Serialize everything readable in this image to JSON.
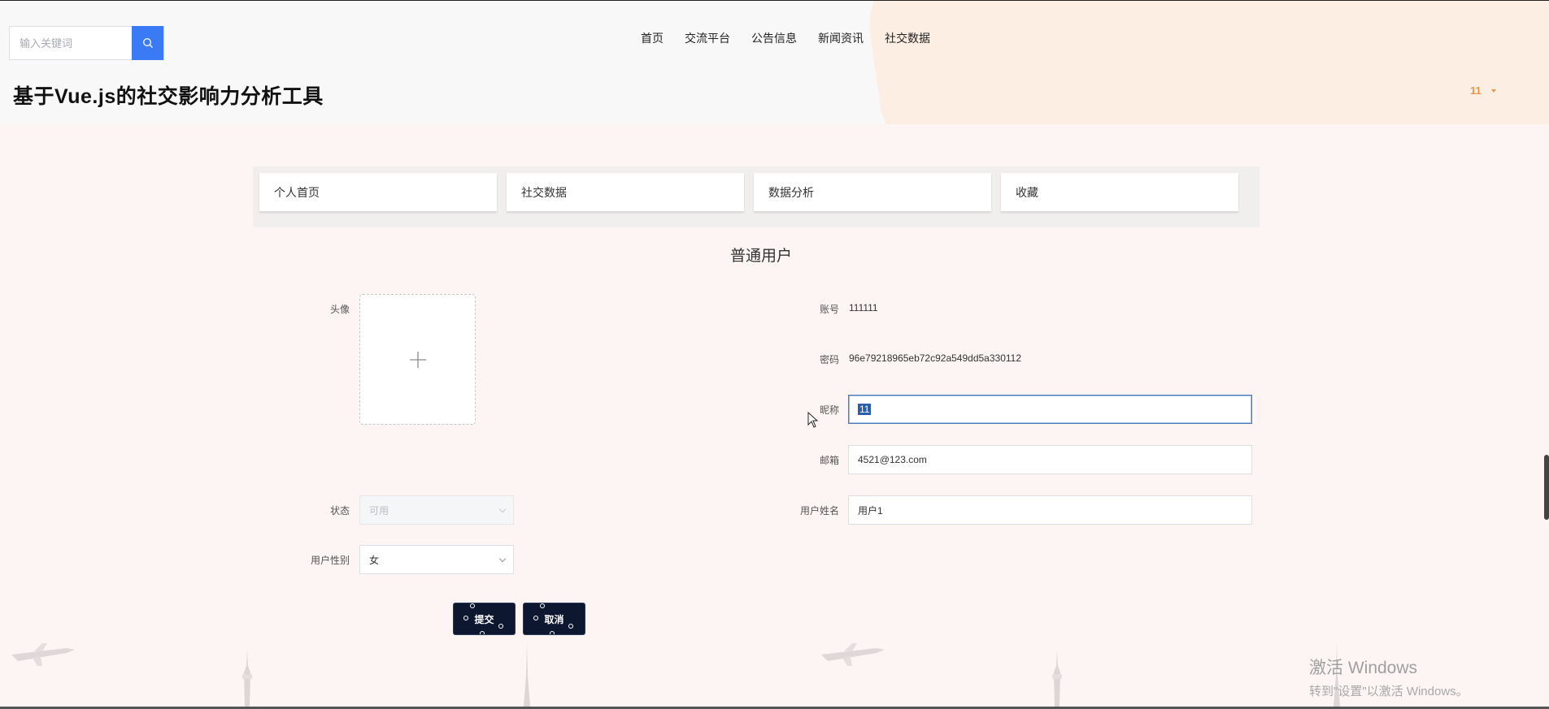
{
  "header": {
    "search": {
      "placeholder": "输入关键词",
      "value": ""
    },
    "nav": [
      "首页",
      "交流平台",
      "公告信息",
      "新闻资讯",
      "社交数据"
    ],
    "site_title": "基于Vue.js的社交影响力分析工具",
    "user": "11"
  },
  "tabs": [
    "个人首页",
    "社交数据",
    "数据分析",
    "收藏"
  ],
  "section_title": "普通用户",
  "form": {
    "avatar_label": "头像",
    "account_label": "账号",
    "account_value": "111111",
    "password_label": "密码",
    "password_value": "96e79218965eb72c92a549dd5a330112",
    "nickname_label": "昵称",
    "nickname_value": "11",
    "email_label": "邮箱",
    "email_value": "4521@123.com",
    "status_label": "状态",
    "status_value": "可用",
    "username_label": "用户姓名",
    "username_value": "用户1",
    "gender_label": "用户性别",
    "gender_value": "女"
  },
  "buttons": {
    "submit": "提交",
    "cancel": "取消"
  },
  "watermark": {
    "line1": "激活 Windows",
    "line2": "转到\"设置\"以激活 Windows。"
  },
  "colors": {
    "accent": "#3a7bf5",
    "user": "#e6974a",
    "button": "#0d1730",
    "focus": "#4a7fb8"
  }
}
